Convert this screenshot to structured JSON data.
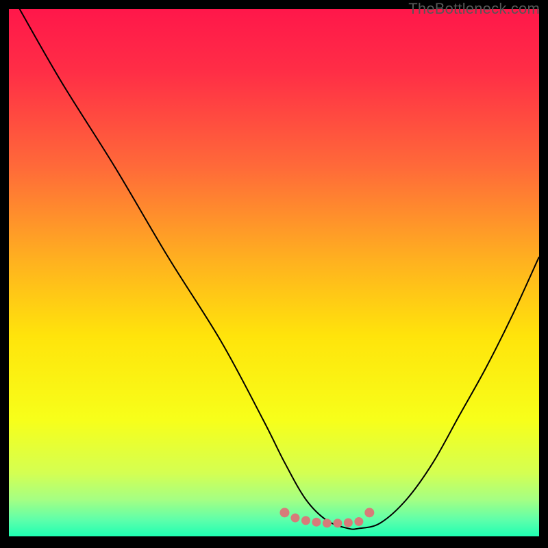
{
  "watermark": "TheBottleneck.com",
  "chart_data": {
    "type": "line",
    "title": "",
    "xlabel": "",
    "ylabel": "",
    "xlim": [
      0,
      100
    ],
    "ylim": [
      0,
      100
    ],
    "grid": false,
    "legend": false,
    "annotations": [],
    "series": [
      {
        "name": "bottleneck-curve",
        "x": [
          2,
          10,
          20,
          30,
          40,
          48,
          52,
          56,
          60,
          64,
          66,
          70,
          75,
          80,
          85,
          90,
          95,
          100
        ],
        "y": [
          100,
          86,
          70,
          53,
          37,
          22,
          14,
          7,
          3,
          1.5,
          1.5,
          2.5,
          7,
          14,
          23,
          32,
          42,
          53
        ]
      }
    ],
    "highlight": {
      "name": "optimal-zone-dots",
      "color": "#d77b79",
      "x": [
        52,
        54,
        56,
        58,
        60,
        62,
        64,
        66,
        68
      ],
      "y": [
        4.5,
        3.5,
        3,
        2.7,
        2.5,
        2.5,
        2.6,
        2.8,
        4.5
      ]
    },
    "gradient_stops": [
      {
        "offset": 0.0,
        "color": "#ff174a"
      },
      {
        "offset": 0.12,
        "color": "#ff2e46"
      },
      {
        "offset": 0.3,
        "color": "#ff6a39"
      },
      {
        "offset": 0.48,
        "color": "#ffb21f"
      },
      {
        "offset": 0.62,
        "color": "#ffe40b"
      },
      {
        "offset": 0.78,
        "color": "#f7ff1a"
      },
      {
        "offset": 0.88,
        "color": "#d4ff52"
      },
      {
        "offset": 0.93,
        "color": "#a5ff83"
      },
      {
        "offset": 0.97,
        "color": "#5cffab"
      },
      {
        "offset": 1.0,
        "color": "#1effb2"
      }
    ]
  }
}
